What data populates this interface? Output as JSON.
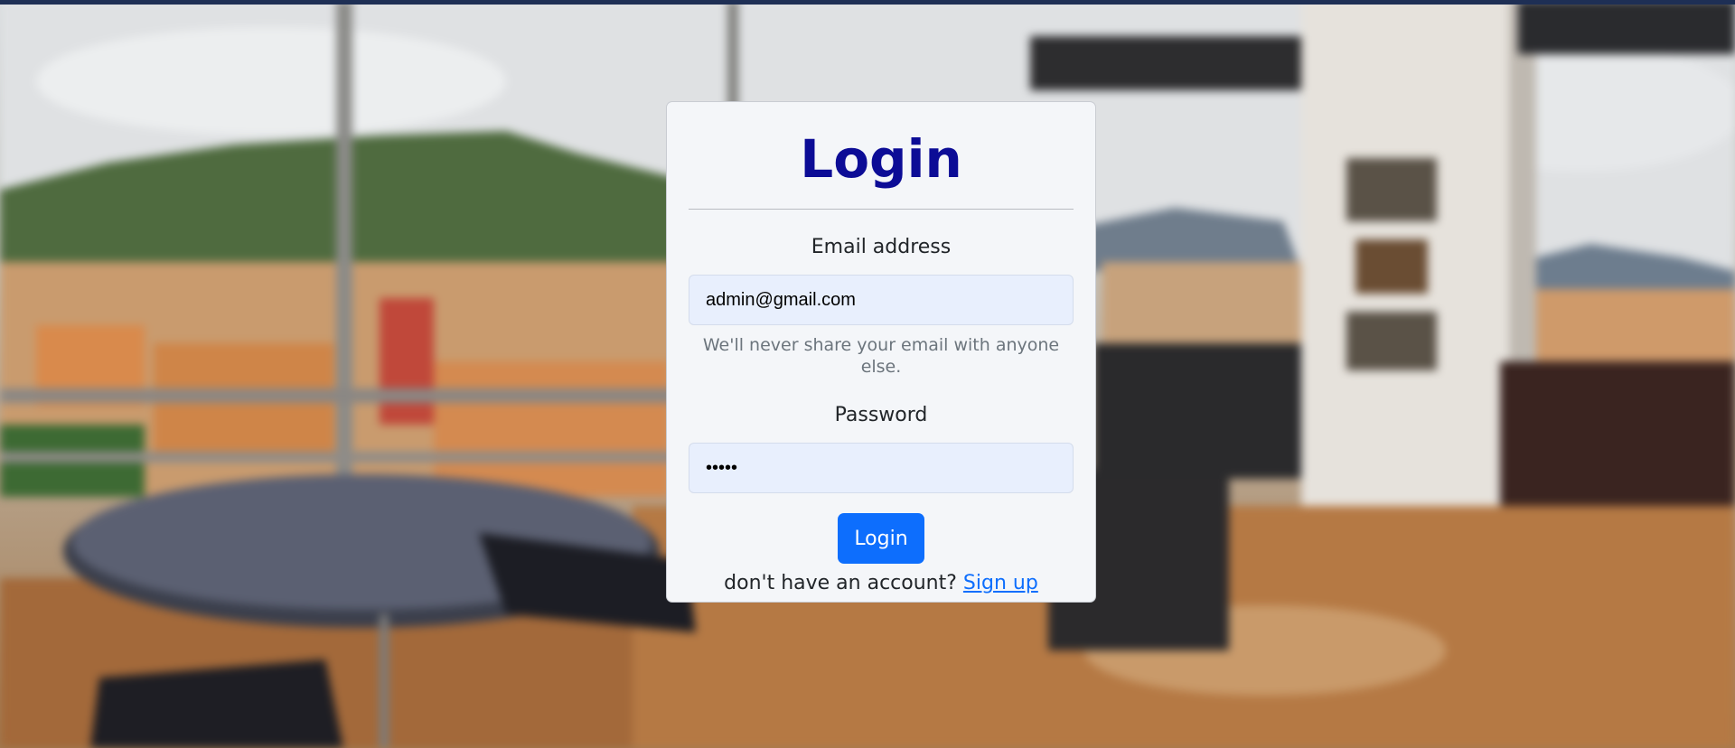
{
  "colors": {
    "title": "#0c0c96",
    "button": "#0d6efd",
    "link": "#0d6efd",
    "input_bg": "#e8effd",
    "card_bg": "#f4f6f9"
  },
  "login_card": {
    "title": "Login",
    "email_label": "Email address",
    "email_value": "admin@gmail.com",
    "email_help": "We'll never share your email with anyone else.",
    "password_label": "Password",
    "password_value": "•••••",
    "submit_label": "Login",
    "signup_prompt": "don't have an account?",
    "signup_link": "Sign up"
  }
}
